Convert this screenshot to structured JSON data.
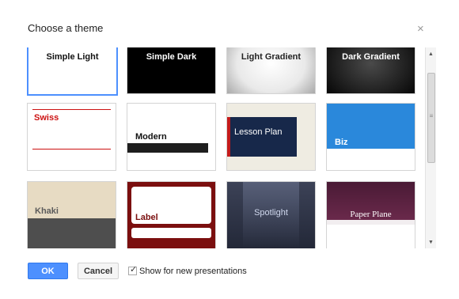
{
  "dialog": {
    "title": "Choose a theme",
    "close_glyph": "×"
  },
  "themes": [
    {
      "name": "Simple Light"
    },
    {
      "name": "Simple Dark"
    },
    {
      "name": "Light Gradient"
    },
    {
      "name": "Dark Gradient"
    },
    {
      "name": "Swiss"
    },
    {
      "name": "Modern"
    },
    {
      "name": "Lesson Plan"
    },
    {
      "name": "Biz"
    },
    {
      "name": "Khaki"
    },
    {
      "name": "Label"
    },
    {
      "name": "Spotlight"
    },
    {
      "name": "Paper Plane"
    }
  ],
  "selected_theme": "Simple Light",
  "scrollbar": {
    "up_glyph": "▲",
    "down_glyph": "▼",
    "grip_glyph": "≡"
  },
  "footer": {
    "ok_label": "OK",
    "cancel_label": "Cancel",
    "checkbox_label": "Show for new presentations",
    "checkbox_checked": true,
    "check_glyph": "✓"
  },
  "colors": {
    "accent_blue": "#4d90fe",
    "swiss_red": "#cc1111",
    "label_maroon": "#7b0f0f",
    "biz_blue": "#2a88db",
    "lesson_navy": "#17284a",
    "paper_purple": "#5c2440",
    "khaki_dark": "#4e4e4e"
  }
}
